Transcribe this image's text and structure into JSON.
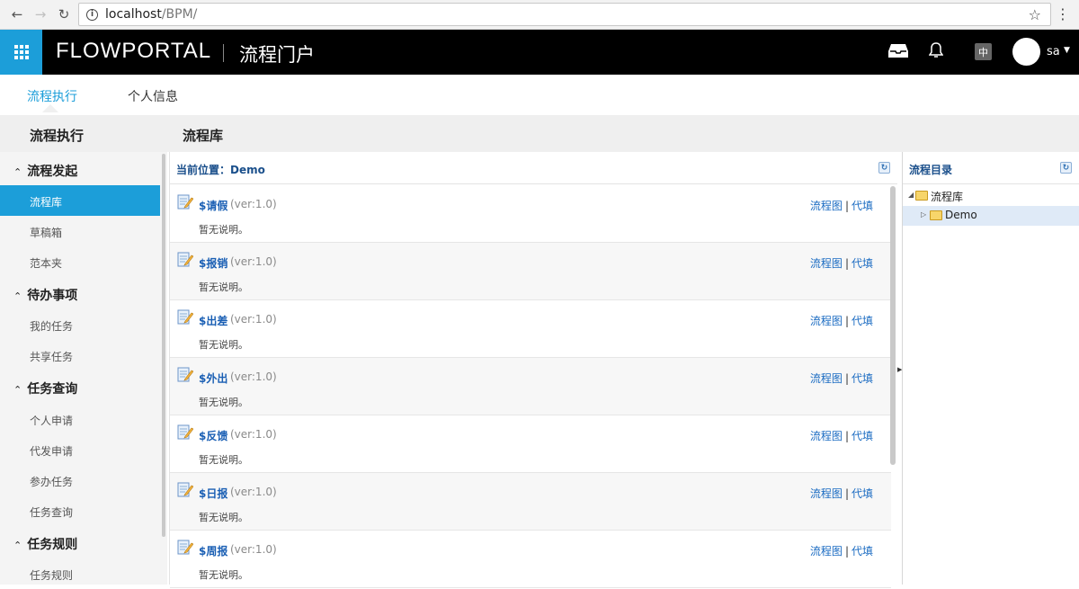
{
  "browser": {
    "url_host": "localhost",
    "url_path": "/BPM/"
  },
  "header": {
    "brand": "FLOWPORTAL",
    "subtitle": "流程门户",
    "lang": "中",
    "user": "sa"
  },
  "top_tabs": [
    {
      "label": "流程执行",
      "active": true
    },
    {
      "label": "个人信息",
      "active": false
    }
  ],
  "sidebar": {
    "title": "流程执行",
    "groups": [
      {
        "label": "流程发起",
        "items": [
          "流程库",
          "草稿箱",
          "范本夹"
        ]
      },
      {
        "label": "待办事项",
        "items": [
          "我的任务",
          "共享任务"
        ]
      },
      {
        "label": "任务查询",
        "items": [
          "个人申请",
          "代发申请",
          "参办任务",
          "任务查询"
        ]
      },
      {
        "label": "任务规则",
        "items": [
          "任务规则"
        ]
      }
    ]
  },
  "main": {
    "title": "流程库",
    "location": "当前位置：Demo",
    "processes": [
      {
        "name": "$请假",
        "ver": "(ver:1.0)",
        "desc": "暂无说明。"
      },
      {
        "name": "$报销",
        "ver": "(ver:1.0)",
        "desc": "暂无说明。"
      },
      {
        "name": "$出差",
        "ver": "(ver:1.0)",
        "desc": "暂无说明。"
      },
      {
        "name": "$外出",
        "ver": "(ver:1.0)",
        "desc": "暂无说明。"
      },
      {
        "name": "$反馈",
        "ver": "(ver:1.0)",
        "desc": "暂无说明。"
      },
      {
        "name": "$日报",
        "ver": "(ver:1.0)",
        "desc": "暂无说明。"
      },
      {
        "name": "$周报",
        "ver": "(ver:1.0)",
        "desc": "暂无说明。"
      }
    ],
    "link_chart": "流程图",
    "link_proxy": "代填"
  },
  "tree": {
    "title": "流程目录",
    "root": "流程库",
    "child": "Demo"
  },
  "colors": {
    "accent": "#1c9ed9",
    "link": "#1a6bc2"
  }
}
